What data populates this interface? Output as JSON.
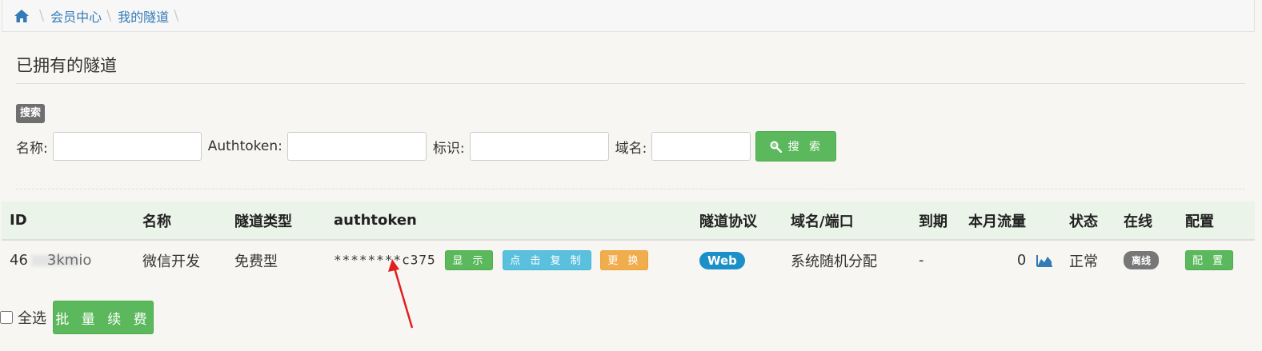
{
  "breadcrumb": {
    "items": [
      "会员中心",
      "我的隧道"
    ]
  },
  "section_title": "已拥有的隧道",
  "search": {
    "badge": "搜索",
    "fields": [
      {
        "label": "名称:",
        "value": ""
      },
      {
        "label": "Authtoken:",
        "value": ""
      },
      {
        "label": "标识:",
        "value": ""
      },
      {
        "label": "域名:",
        "value": ""
      }
    ],
    "button": "搜 索"
  },
  "table": {
    "headers": [
      "ID",
      "名称",
      "隧道类型",
      "authtoken",
      "隧道协议",
      "域名/端口",
      "到期",
      "本月流量",
      "状态",
      "在线",
      "配置"
    ],
    "rows": [
      {
        "id_prefix": "46",
        "id_suffix": "3kmio",
        "name": "微信开发",
        "type": "免费型",
        "authtoken": "********c375",
        "show_btn": "显 示",
        "copy_btn": "点 击 复 制",
        "change_btn": "更 换",
        "protocol": "Web",
        "domain": "系统随机分配",
        "expire": "-",
        "traffic": "0",
        "status": "正常",
        "online": "离线",
        "config_btn": "配 置"
      }
    ]
  },
  "footer": {
    "select_all": "全选",
    "renew_button": "批 量 续 费"
  },
  "colors": {
    "green": "#5cb85c",
    "cyan": "#5bc0de",
    "orange": "#f0ad4e",
    "blue": "#1a8fc8",
    "link": "#337ab7"
  }
}
